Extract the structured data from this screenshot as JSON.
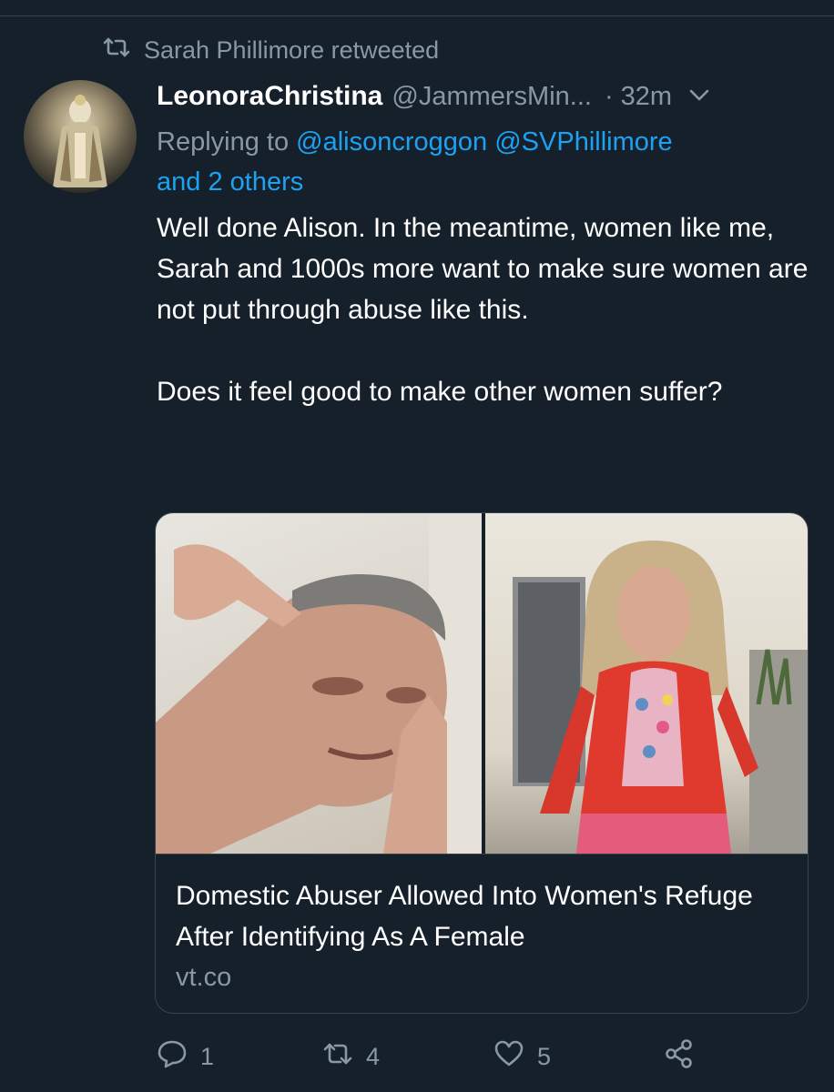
{
  "retweet": {
    "by": "Sarah Phillimore retweeted"
  },
  "tweet": {
    "display_name": "LeonoraChristina",
    "handle": "@JammersMin...",
    "time": "· 32m",
    "replying_prefix": "Replying to",
    "mention_1": "@alisoncroggon",
    "mention_2": "@SVPhillimore",
    "mention_more": "and 2 others",
    "text": "Well done Alison. In the meantime, women like me, Sarah and 1000s more want to make sure women are not put through abuse like this.\n\nDoes it feel good to make other women suffer?"
  },
  "card": {
    "title": "Domestic Abuser Allowed Into Women's Refuge After Identifying As A Female",
    "domain": "vt.co"
  },
  "actions": {
    "reply_count": "1",
    "retweet_count": "4",
    "like_count": "5"
  },
  "colors": {
    "background": "#15202b",
    "secondary_text": "#8899a6",
    "link": "#1da1f2",
    "border": "#38444d"
  },
  "icons": [
    "retweet-icon",
    "chevron-down-icon",
    "reply-icon",
    "retweet-icon",
    "heart-icon",
    "share-icon"
  ]
}
